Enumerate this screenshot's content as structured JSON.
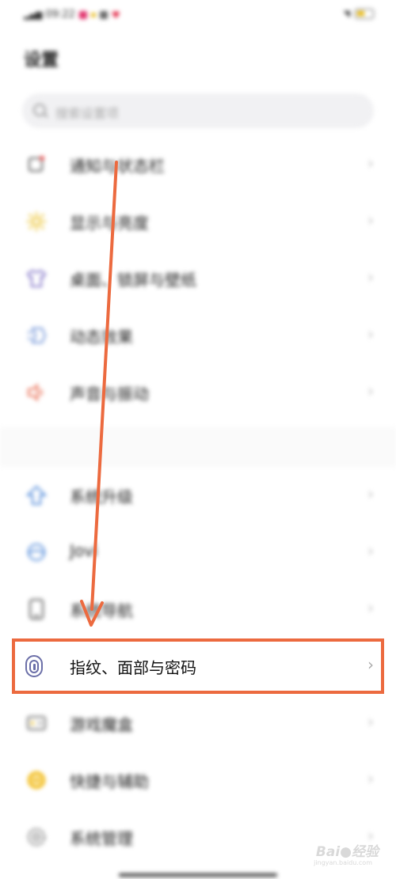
{
  "status_bar": {
    "signal": "⁶⁴⁴",
    "time": "09:22",
    "wifi": "⋯"
  },
  "page_title": "设置",
  "search": {
    "placeholder": "搜索设置项"
  },
  "settings_items": [
    {
      "label": "通知与状态栏",
      "icon": "notification-icon"
    },
    {
      "label": "显示与亮度",
      "icon": "brightness-icon"
    },
    {
      "label": "桌面、锁屏与壁纸",
      "icon": "theme-shirt-icon"
    },
    {
      "label": "动态效果",
      "icon": "motion-effect-icon"
    },
    {
      "label": "声音与振动",
      "icon": "speaker-icon"
    },
    {
      "label": "系统升级",
      "icon": "upgrade-arrow-icon"
    },
    {
      "label": "Jovi",
      "icon": "jovi-icon"
    },
    {
      "label": "系统导航",
      "icon": "phone-navigation-icon"
    },
    {
      "label": "指纹、面部与密码",
      "icon": "fingerprint-icon"
    },
    {
      "label": "游戏魔盒",
      "icon": "game-box-icon"
    },
    {
      "label": "快捷与辅助",
      "icon": "shortcut-icon"
    },
    {
      "label": "系统管理",
      "icon": "system-management-icon"
    }
  ],
  "chevron": "›",
  "annotation": {
    "color": "#ec6a3f"
  },
  "watermark": {
    "brand": "Bai●经验",
    "url": "jingyan.baidu.com"
  }
}
